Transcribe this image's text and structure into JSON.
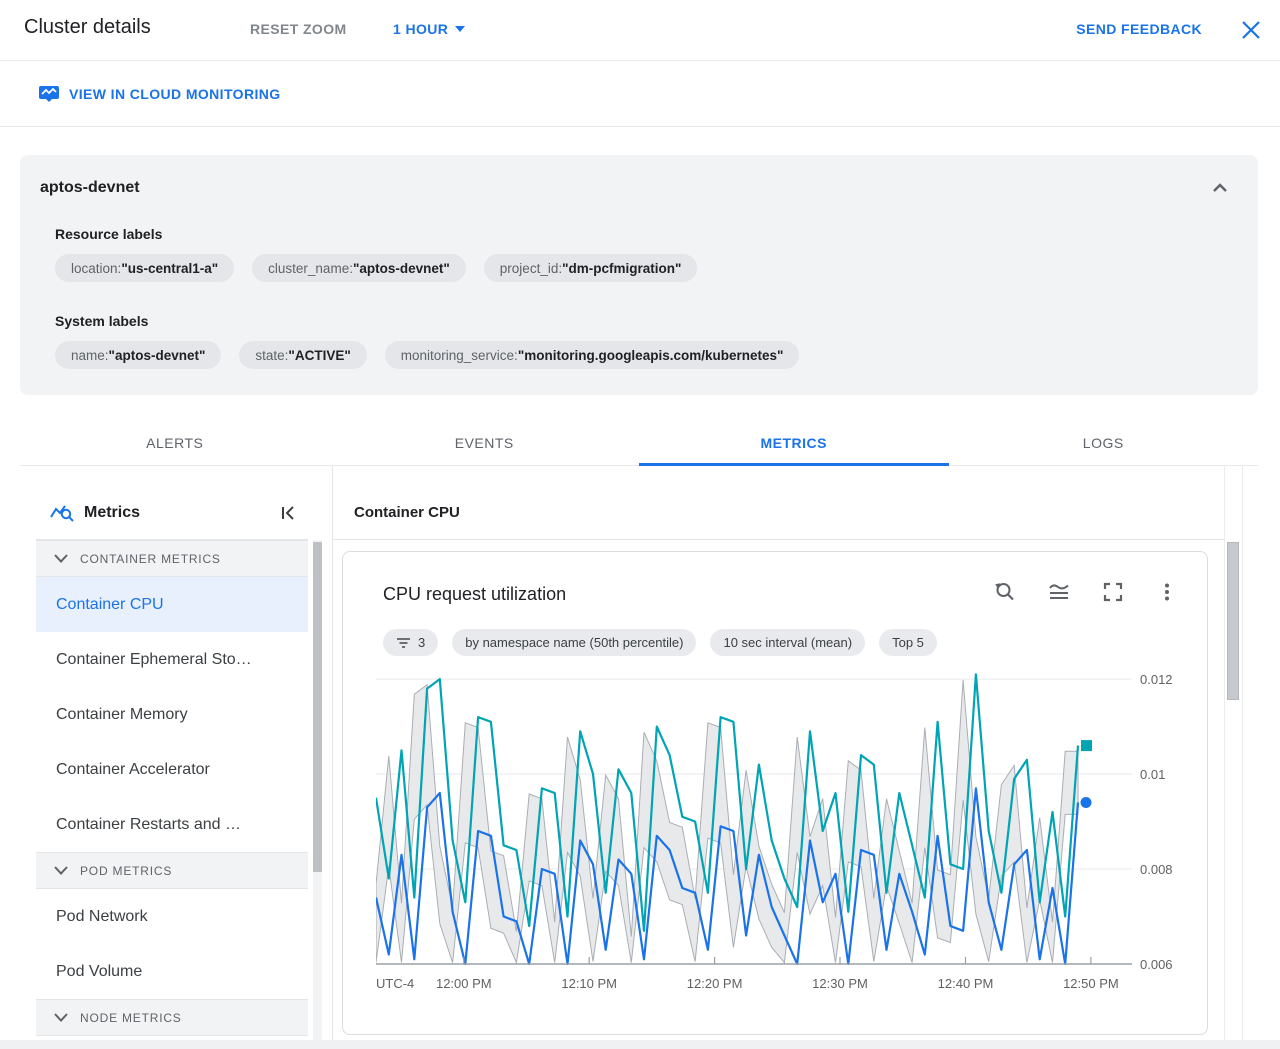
{
  "header": {
    "title": "Cluster details",
    "reset_zoom": "RESET ZOOM",
    "time_range": "1 HOUR",
    "send_feedback": "SEND FEEDBACK"
  },
  "monitoring_link": {
    "label": "VIEW IN CLOUD MONITORING"
  },
  "cluster_panel": {
    "name": "aptos-devnet",
    "separator": " : ",
    "resource_labels_title": "Resource labels",
    "resource_labels": [
      {
        "key": "location",
        "value": "\"us-central1-a\""
      },
      {
        "key": "cluster_name",
        "value": "\"aptos-devnet\""
      },
      {
        "key": "project_id",
        "value": "\"dm-pcfmigration\""
      }
    ],
    "system_labels_title": "System labels",
    "system_labels": [
      {
        "key": "name",
        "value": "\"aptos-devnet\""
      },
      {
        "key": "state",
        "value": "\"ACTIVE\""
      },
      {
        "key": "monitoring_service",
        "value": "\"monitoring.googleapis.com/kubernetes\""
      }
    ]
  },
  "tabs": [
    {
      "label": "ALERTS"
    },
    {
      "label": "EVENTS"
    },
    {
      "label": "METRICS",
      "active": true
    },
    {
      "label": "LOGS"
    }
  ],
  "sidebar": {
    "title": "Metrics",
    "sections": [
      {
        "label": "CONTAINER METRICS",
        "items": [
          {
            "label": "Container CPU",
            "selected": true
          },
          {
            "label": "Container Ephemeral Sto…"
          },
          {
            "label": "Container Memory"
          },
          {
            "label": "Container Accelerator"
          },
          {
            "label": "Container Restarts and …"
          }
        ]
      },
      {
        "label": "POD METRICS",
        "items": [
          {
            "label": "Pod Network"
          },
          {
            "label": "Pod Volume"
          }
        ]
      },
      {
        "label": "NODE METRICS",
        "items": []
      }
    ]
  },
  "main": {
    "header": "Container CPU",
    "card": {
      "title": "CPU request utilization",
      "chips": [
        {
          "icon": "filter-list-icon",
          "label": "3"
        },
        {
          "label": "by namespace name (50th percentile)"
        },
        {
          "label": "10 sec interval (mean)"
        },
        {
          "label": "Top 5"
        }
      ]
    }
  },
  "colors": {
    "accent": "#1a73e8",
    "teal": "#00a4b4",
    "selected_bg": "#e8f0fe",
    "band_fill": "#e4e5e7",
    "band_stroke": "#a9aeb4"
  },
  "chart_data": {
    "type": "line",
    "title": "CPU request utilization",
    "breakdown": "by namespace name (50th percentile)",
    "aggregation": "10 sec interval (mean)",
    "top_filter": "Top 5",
    "grid": true,
    "legend": false,
    "x_axis": {
      "timezone_label": "UTC-4",
      "ticks": [
        "12:00 PM",
        "12:10 PM",
        "12:20 PM",
        "12:30 PM",
        "12:40 PM",
        "12:50 PM"
      ],
      "tick_minutes": [
        0,
        10,
        20,
        30,
        40,
        50
      ],
      "range_minutes": [
        -7,
        52.8
      ]
    },
    "y_axis": {
      "tick_labels": [
        "0.006",
        "0.008",
        "0.01",
        "0.012"
      ],
      "ticks": [
        0.006,
        0.008,
        0.01,
        0.012
      ],
      "range": [
        0.006,
        0.01217
      ],
      "side": "right"
    },
    "series": [
      {
        "name": "teal-series",
        "color": "#00a4b4",
        "marker": "square",
        "values": [
          0.0095,
          0.0078,
          0.0105,
          0.0074,
          0.0118,
          0.012,
          0.0086,
          0.0073,
          0.0112,
          0.0111,
          0.0085,
          0.0084,
          0.0068,
          0.0097,
          0.0096,
          0.007,
          0.0109,
          0.01,
          0.0075,
          0.0101,
          0.0096,
          0.0067,
          0.011,
          0.0104,
          0.0091,
          0.009,
          0.0075,
          0.0112,
          0.0111,
          0.008,
          0.0102,
          0.0086,
          0.0078,
          0.0072,
          0.0109,
          0.0088,
          0.0096,
          0.0071,
          0.0104,
          0.0102,
          0.0075,
          0.0096,
          0.0085,
          0.0074,
          0.0111,
          0.0081,
          0.008,
          0.0121,
          0.0088,
          0.0075,
          0.0099,
          0.0103,
          0.0073,
          0.0092,
          0.007,
          0.0106
        ]
      },
      {
        "name": "blue-series",
        "color": "#1a73e8",
        "marker": "circle",
        "values": [
          0.0074,
          0.0062,
          0.0083,
          0.0061,
          0.0093,
          0.0096,
          0.0071,
          0.006,
          0.0088,
          0.0087,
          0.007,
          0.0069,
          0.006,
          0.008,
          0.0079,
          0.006,
          0.0086,
          0.0081,
          0.0063,
          0.0082,
          0.0079,
          0.0061,
          0.0087,
          0.0084,
          0.0076,
          0.0075,
          0.0063,
          0.0089,
          0.0088,
          0.0066,
          0.0083,
          0.0072,
          0.0066,
          0.006,
          0.0086,
          0.0073,
          0.0079,
          0.006,
          0.0084,
          0.0083,
          0.0063,
          0.0079,
          0.0071,
          0.0062,
          0.0087,
          0.0068,
          0.0067,
          0.0097,
          0.0073,
          0.0063,
          0.0081,
          0.0084,
          0.0061,
          0.0076,
          0.006,
          0.0094
        ]
      }
    ],
    "band": {
      "fill": "#e4e5e7",
      "stroke": "#a9aeb4",
      "description": "gray min-max range band behind the two lines"
    }
  }
}
